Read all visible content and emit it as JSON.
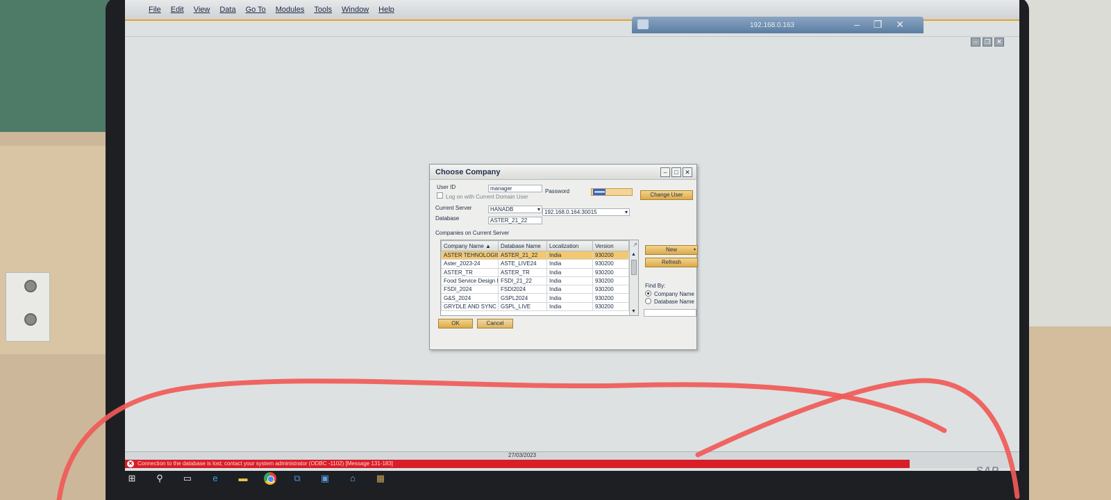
{
  "menu": [
    "File",
    "Edit",
    "View",
    "Data",
    "Go To",
    "Modules",
    "Tools",
    "Window",
    "Help"
  ],
  "remote_session": {
    "ip": "192.168.0.163"
  },
  "dialog": {
    "title": "Choose Company",
    "user_id_label": "User ID",
    "user_id_value": "manager",
    "password_label": "Password",
    "password_value": "••••••••",
    "domain_logon_label": "Log on with Current Domain User",
    "change_user_label": "Change User",
    "current_server_label": "Current Server",
    "current_server_value": "HANADB",
    "server_address_value": "192.168.0.164:30015",
    "database_label": "Database",
    "database_value": "ASTER_21_22",
    "companies_label": "Companies on Current Server",
    "columns": [
      "Company Name",
      "Database Name",
      "Localization",
      "Version"
    ],
    "rows": [
      [
        "ASTER TEHNOLOGIES",
        "ASTER_21_22",
        "India",
        "930200"
      ],
      [
        "Aster_2023-24",
        "ASTE_LIVE24",
        "India",
        "930200"
      ],
      [
        "ASTER_TR",
        "ASTER_TR",
        "India",
        "930200"
      ],
      [
        "Food Service Design I",
        "FSDI_21_22",
        "India",
        "930200"
      ],
      [
        "FSDI_2024",
        "FSDI2024",
        "India",
        "930200"
      ],
      [
        "G&S_2024",
        "GSPL2024",
        "India",
        "930200"
      ],
      [
        "GRYDLE AND SYNC PI",
        "GSPL_LIVE",
        "India",
        "930200"
      ]
    ],
    "selected_row": 0,
    "new_label": "New",
    "refresh_label": "Refresh",
    "find_by_label": "Find By:",
    "find_by_options": [
      "Company Name",
      "Database Name"
    ],
    "find_by_selected": "Company Name",
    "ok_label": "OK",
    "cancel_label": "Cancel"
  },
  "status": {
    "error_message": "Connection to the database is lost; contact your system administrator (ODBC -1102)  [Message 131-183]",
    "date": "27/03/2023"
  },
  "brand": {
    "logo_text": "SAP",
    "accent": "#e3a528",
    "error_color": "#d81e28"
  },
  "taskbar_icons": [
    "windows-start-icon",
    "search-icon",
    "task-view-icon",
    "edge-browser-icon",
    "file-explorer-icon",
    "chrome-icon",
    "network-app-icon",
    "windows-app-icon",
    "network-icon",
    "sap-app-icon"
  ]
}
